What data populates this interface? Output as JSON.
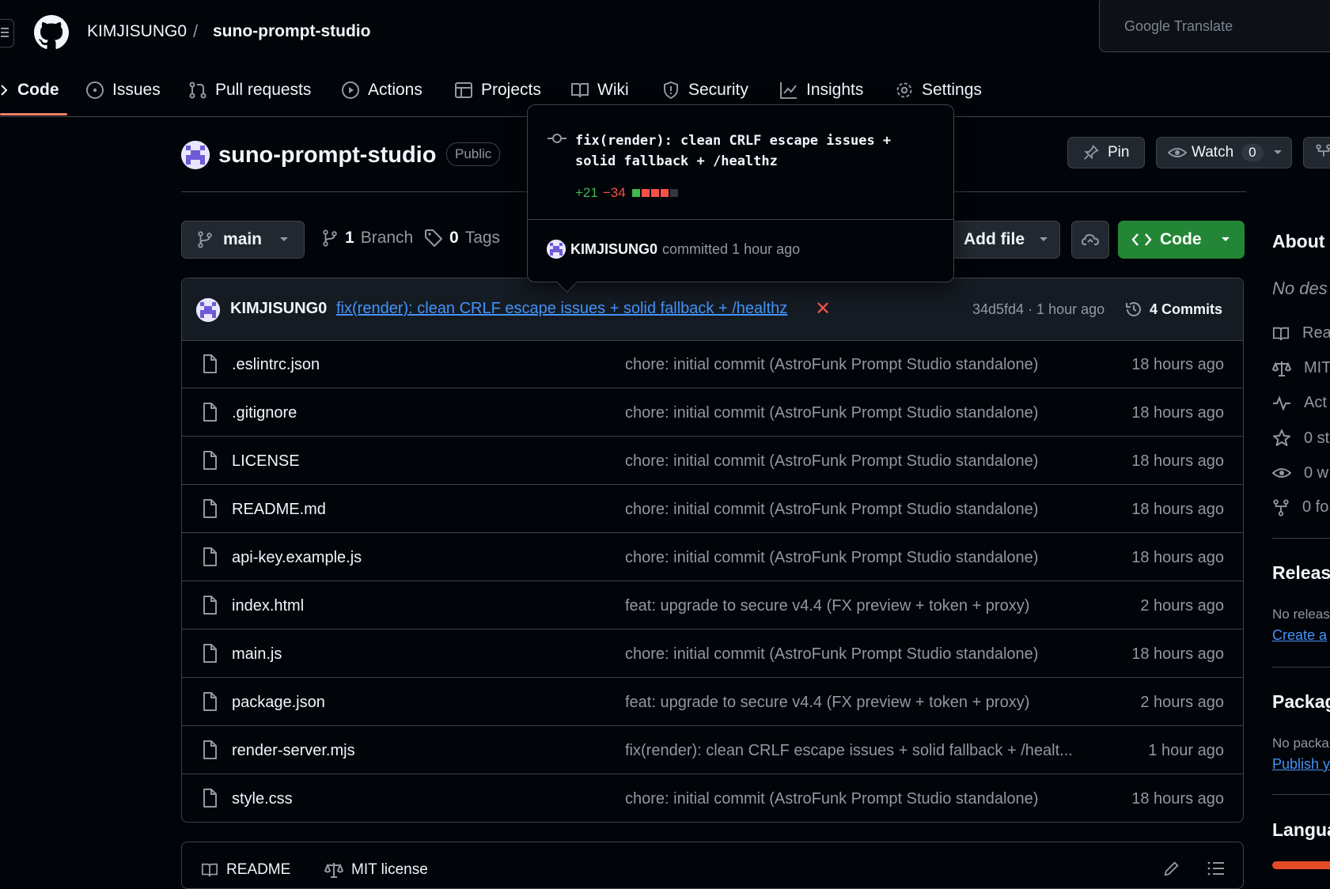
{
  "header": {
    "owner": "KIMJISUNG0",
    "separator": "/",
    "repo": "suno-prompt-studio",
    "translate_label": "Google Translate"
  },
  "tabs": [
    {
      "label": "Code",
      "icon": "code-icon",
      "active": true
    },
    {
      "label": "Issues",
      "icon": "issue-opened-icon"
    },
    {
      "label": "Pull requests",
      "icon": "git-pull-request-icon"
    },
    {
      "label": "Actions",
      "icon": "play-icon"
    },
    {
      "label": "Projects",
      "icon": "table-icon"
    },
    {
      "label": "Wiki",
      "icon": "book-icon"
    },
    {
      "label": "Security",
      "icon": "shield-icon"
    },
    {
      "label": "Insights",
      "icon": "graph-icon"
    },
    {
      "label": "Settings",
      "icon": "gear-icon"
    }
  ],
  "repo": {
    "name": "suno-prompt-studio",
    "visibility": "Public",
    "pin_label": "Pin",
    "watch_label": "Watch",
    "watch_count": "0"
  },
  "toolbar": {
    "branch": "main",
    "branch_count": "1",
    "branch_label": "Branch",
    "tag_count": "0",
    "tag_label": "Tags",
    "add_file_label": "Add file",
    "code_label": "Code"
  },
  "latest_commit": {
    "author": "KIMJISUNG0",
    "message": "fix(render): clean CRLF escape issues + solid fallback + /healthz",
    "status": "✕",
    "hash_time": "34d5fd4 · 1 hour ago",
    "commits_label": "4 Commits"
  },
  "files": [
    {
      "name": ".eslintrc.json",
      "message": "chore: initial commit (AstroFunk Prompt Studio standalone)",
      "time": "18 hours ago"
    },
    {
      "name": ".gitignore",
      "message": "chore: initial commit (AstroFunk Prompt Studio standalone)",
      "time": "18 hours ago"
    },
    {
      "name": "LICENSE",
      "message": "chore: initial commit (AstroFunk Prompt Studio standalone)",
      "time": "18 hours ago"
    },
    {
      "name": "README.md",
      "message": "chore: initial commit (AstroFunk Prompt Studio standalone)",
      "time": "18 hours ago"
    },
    {
      "name": "api-key.example.js",
      "message": "chore: initial commit (AstroFunk Prompt Studio standalone)",
      "time": "18 hours ago"
    },
    {
      "name": "index.html",
      "message": "feat: upgrade to secure v4.4 (FX preview + token + proxy)",
      "time": "2 hours ago"
    },
    {
      "name": "main.js",
      "message": "chore: initial commit (AstroFunk Prompt Studio standalone)",
      "time": "18 hours ago"
    },
    {
      "name": "package.json",
      "message": "feat: upgrade to secure v4.4 (FX preview + token + proxy)",
      "time": "2 hours ago"
    },
    {
      "name": "render-server.mjs",
      "message": "fix(render): clean CRLF escape issues + solid fallback + /healt...",
      "time": "1 hour ago"
    },
    {
      "name": "style.css",
      "message": "chore: initial commit (AstroFunk Prompt Studio standalone)",
      "time": "18 hours ago"
    }
  ],
  "readme_tabs": {
    "readme": "README",
    "license": "MIT license"
  },
  "sidebar": {
    "about_title": "About",
    "description": "No des",
    "items": [
      {
        "icon": "book-icon",
        "label": "Rea"
      },
      {
        "icon": "law-icon",
        "label": "MIT"
      },
      {
        "icon": "pulse-icon",
        "label": "Act"
      },
      {
        "icon": "star-icon",
        "label": "0 st"
      },
      {
        "icon": "eye-icon",
        "label": "0 w"
      },
      {
        "icon": "repo-forked-icon",
        "label": "0 fo"
      }
    ],
    "releases_title": "Release",
    "releases_text": "No releas",
    "releases_link": "Create a",
    "packages_title": "Packag",
    "packages_text": "No packa",
    "packages_link": "Publish y",
    "languages_title": "Langua",
    "language_color": "#e34c26"
  },
  "popover": {
    "message": "fix(render): clean CRLF escape issues + solid fallback + /healthz",
    "additions": "+21",
    "deletions": "−34",
    "author": "KIMJISUNG0",
    "committed_text": "committed 1 hour ago"
  },
  "colors": {
    "background": "#010409",
    "accent_tab": "#f78166",
    "code_button": "#238636",
    "link": "#4493f8",
    "danger": "#f85149",
    "success": "#3fb950"
  }
}
